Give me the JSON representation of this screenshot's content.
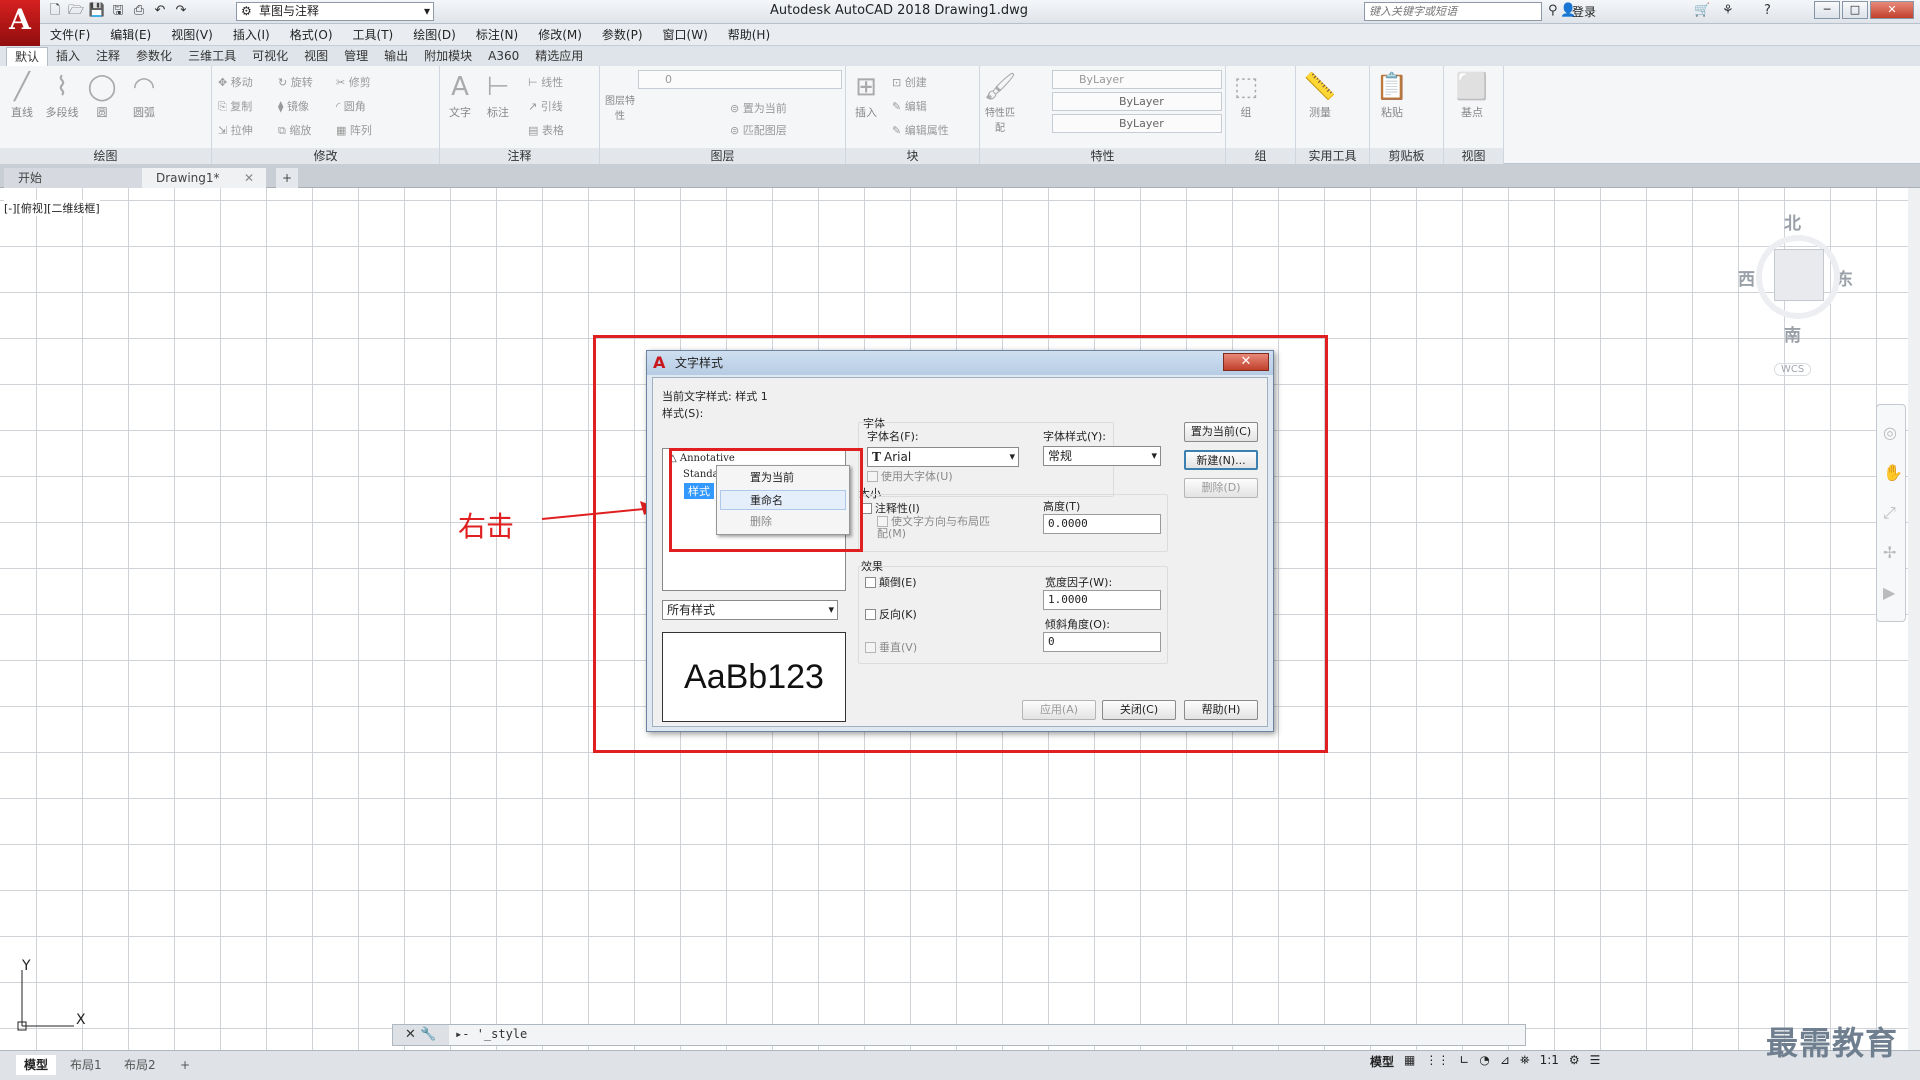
{
  "app": {
    "title": "Autodesk AutoCAD 2018    Drawing1.dwg",
    "logo": "A",
    "workspace": "草图与注释",
    "search_placeholder": "键入关键字或短语",
    "login": "登录"
  },
  "menubar": [
    "文件(F)",
    "编辑(E)",
    "视图(V)",
    "插入(I)",
    "格式(O)",
    "工具(T)",
    "绘图(D)",
    "标注(N)",
    "修改(M)",
    "参数(P)",
    "窗口(W)",
    "帮助(H)"
  ],
  "ribbon_tabs": [
    "默认",
    "插入",
    "注释",
    "参数化",
    "三维工具",
    "可视化",
    "视图",
    "管理",
    "输出",
    "附加模块",
    "A360",
    "精选应用"
  ],
  "ribbon": {
    "draw": {
      "title": "绘图",
      "items": [
        "直线",
        "多段线",
        "圆",
        "圆弧"
      ]
    },
    "modify": {
      "title": "修改",
      "items": [
        "移动",
        "旋转",
        "修剪",
        "复制",
        "镜像",
        "圆角",
        "拉伸",
        "缩放",
        "阵列"
      ]
    },
    "annotation": {
      "title": "注释",
      "items": [
        "文字",
        "标注",
        "线性",
        "引线",
        "表格"
      ]
    },
    "layers": {
      "title": "图层",
      "layer_value": "0",
      "items": [
        "图层特性",
        "置为当前",
        "匹配图层"
      ]
    },
    "block": {
      "title": "块",
      "items": [
        "插入",
        "创建",
        "编辑",
        "编辑属性"
      ]
    },
    "properties": {
      "title": "特性",
      "bylayer1": "ByLayer",
      "bylayer2": "ByLayer",
      "bylayer3": "ByLayer",
      "items": [
        "特性匹配"
      ]
    },
    "groups": {
      "title": "组",
      "items": [
        "组"
      ]
    },
    "utilities": {
      "title": "实用工具",
      "items": [
        "测量"
      ]
    },
    "clipboard": {
      "title": "剪贴板",
      "items": [
        "粘贴"
      ]
    },
    "view": {
      "title": "视图",
      "items": [
        "基点"
      ]
    }
  },
  "doc_tabs": [
    "开始",
    "Drawing1*"
  ],
  "viewport_label": "[-][俯视][二维线框]",
  "viewcube": {
    "n": "北",
    "s": "南",
    "e": "东",
    "w": "西",
    "wcs": "WCS"
  },
  "ucs": {
    "y": "Y",
    "x": "X"
  },
  "command_line": "'_style",
  "layout_tabs": [
    "模型",
    "布局1",
    "布局2"
  ],
  "status": {
    "model": "模型",
    "scale": "1:1"
  },
  "watermark": "最需教育",
  "annotation_text": "右击",
  "dialog": {
    "title": "文字样式",
    "current_style_label": "当前文字样式:  样式 1",
    "styles_label": "样式(S):",
    "styles": [
      "Annotative",
      "Standard",
      "样式"
    ],
    "filter": "所有样式",
    "preview": "AaBb123",
    "font_group": "字体",
    "font_name_label": "字体名(F):",
    "font_name": "Arial",
    "font_style_label": "字体样式(Y):",
    "font_style": "常规",
    "use_big_font": "使用大字体(U)",
    "size_group": "大小",
    "annotative": "注释性(I)",
    "match_orientation": "使文字方向与布局匹配(M)",
    "height_label": "高度(T)",
    "height": "0.0000",
    "effects_group": "效果",
    "upside_down": "颠倒(E)",
    "backwards": "反向(K)",
    "vertical": "垂直(V)",
    "width_factor_label": "宽度因子(W):",
    "width_factor": "1.0000",
    "oblique_label": "倾斜角度(O):",
    "oblique": "0",
    "btn_set_current": "置为当前(C)",
    "btn_new": "新建(N)...",
    "btn_delete": "删除(D)",
    "btn_apply": "应用(A)",
    "btn_close": "关闭(C)",
    "btn_help": "帮助(H)"
  },
  "context_menu": [
    "置为当前",
    "重命名",
    "删除"
  ],
  "colors": {
    "highlight": "#e02020",
    "selection": "#3399ff",
    "autocad_red": "#c8181e"
  }
}
